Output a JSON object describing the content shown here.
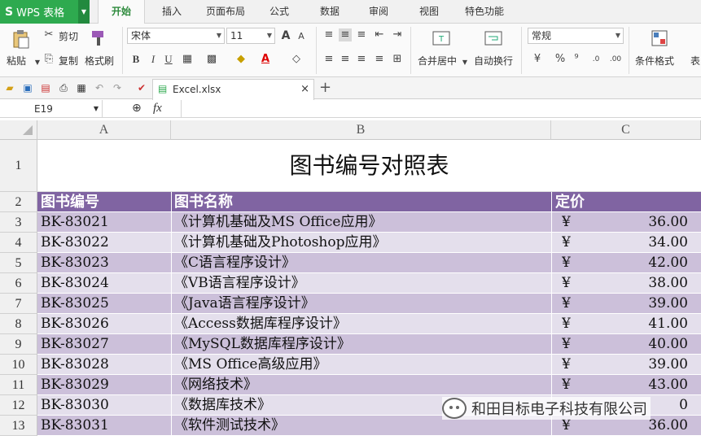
{
  "menubar": {
    "app_name": "WPS 表格",
    "tabs": [
      "开始",
      "插入",
      "页面布局",
      "公式",
      "数据",
      "审阅",
      "视图",
      "特色功能"
    ],
    "active_tab": "开始"
  },
  "ribbon": {
    "paste": "粘贴",
    "cut": "剪切",
    "copy": "复制",
    "format_painter": "格式刷",
    "font_name": "宋体",
    "font_size": "11",
    "bold": "B",
    "italic": "I",
    "underline": "U",
    "merge_center": "合并居中",
    "wrap_text": "自动换行",
    "number_format": "常规",
    "percent": "%",
    "comma": "⁹",
    "cond_format": "条件格式",
    "table_style": "表"
  },
  "filetab": {
    "name": "Excel.xlsx"
  },
  "formula_bar": {
    "cell_ref": "E19",
    "fx": "fx"
  },
  "columns": [
    "A",
    "B",
    "C"
  ],
  "sheet": {
    "title": "图书编号对照表",
    "headers": [
      "图书编号",
      "图书名称",
      "定价"
    ],
    "rows": [
      {
        "num": "3",
        "id": "BK-83021",
        "name": "《计算机基础及MS Office应用》",
        "cur": "¥",
        "price": "36.00"
      },
      {
        "num": "4",
        "id": "BK-83022",
        "name": "《计算机基础及Photoshop应用》",
        "cur": "¥",
        "price": "34.00"
      },
      {
        "num": "5",
        "id": "BK-83023",
        "name": "《C语言程序设计》",
        "cur": "¥",
        "price": "42.00"
      },
      {
        "num": "6",
        "id": "BK-83024",
        "name": "《VB语言程序设计》",
        "cur": "¥",
        "price": "38.00"
      },
      {
        "num": "7",
        "id": "BK-83025",
        "name": "《Java语言程序设计》",
        "cur": "¥",
        "price": "39.00"
      },
      {
        "num": "8",
        "id": "BK-83026",
        "name": "《Access数据库程序设计》",
        "cur": "¥",
        "price": "41.00"
      },
      {
        "num": "9",
        "id": "BK-83027",
        "name": "《MySQL数据库程序设计》",
        "cur": "¥",
        "price": "40.00"
      },
      {
        "num": "10",
        "id": "BK-83028",
        "name": "《MS Office高级应用》",
        "cur": "¥",
        "price": "39.00"
      },
      {
        "num": "11",
        "id": "BK-83029",
        "name": "《网络技术》",
        "cur": "¥",
        "price": "43.00"
      },
      {
        "num": "12",
        "id": "BK-83030",
        "name": "《数据库技术》",
        "cur": "",
        "price": "0"
      },
      {
        "num": "13",
        "id": "BK-83031",
        "name": "《软件测试技术》",
        "cur": "¥",
        "price": "36.00"
      }
    ]
  },
  "watermark": {
    "text": "和田目标电子科技有限公司"
  },
  "colors": {
    "header_bg": "#8064a2",
    "row_dark": "#ccc0da",
    "row_light": "#e4dfec",
    "wps_green": "#2eaa4f"
  }
}
